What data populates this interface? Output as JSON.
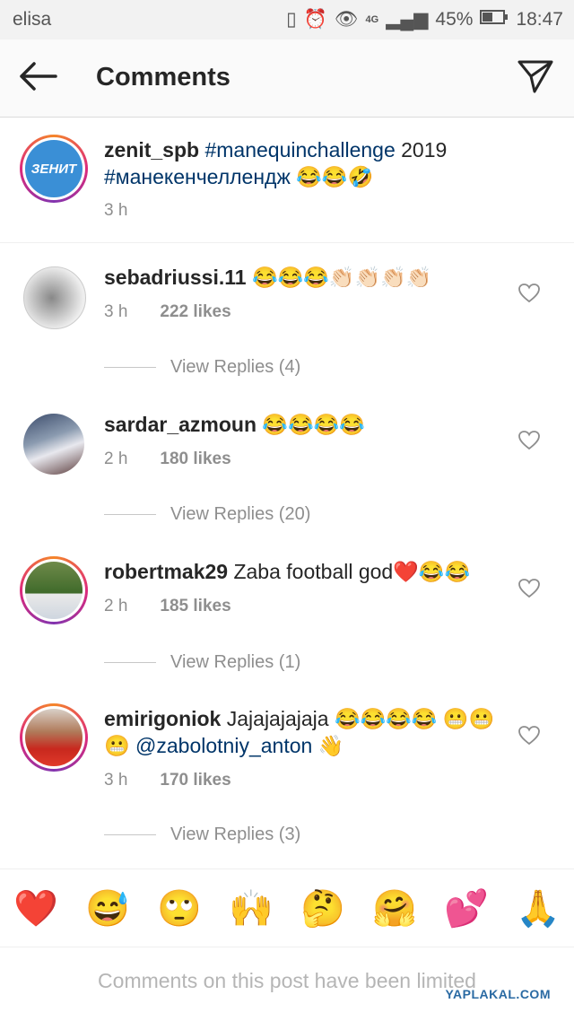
{
  "status_bar": {
    "carrier": "elisa",
    "network": "4G",
    "battery": "45%",
    "time": "18:47"
  },
  "header": {
    "title": "Comments"
  },
  "caption": {
    "username": "zenit_spb",
    "hashtag1": "#manequinchallenge",
    "year": "2019",
    "hashtag2": "#манекенчеллендж",
    "emoji": "😂😂🤣",
    "time": "3 h"
  },
  "comments": [
    {
      "username": "sebadriussi.11",
      "text": "😂😂😂👏🏻👏🏻👏🏻👏🏻",
      "time": "3 h",
      "likes": "222 likes",
      "replies": "View Replies (4)"
    },
    {
      "username": "sardar_azmoun",
      "text": "😂😂😂😂",
      "time": "2 h",
      "likes": "180 likes",
      "replies": "View Replies (20)"
    },
    {
      "username": "robertmak29",
      "text": "Zaba football god❤️😂😂",
      "time": "2 h",
      "likes": "185 likes",
      "replies": "View Replies (1)"
    },
    {
      "username": "emirigoniok",
      "text": "Jajajajajaja 😂😂😂😂 😬😬😬",
      "mention": "@zabolotniy_anton",
      "text2": "👋",
      "time": "3 h",
      "likes": "170 likes",
      "replies": "View Replies (3)"
    }
  ],
  "emoji_bar": [
    "❤️",
    "😅",
    "🙄",
    "🙌",
    "🤔",
    "🤗",
    "💕",
    "🙏"
  ],
  "limited_text": "Comments on this post have been limited",
  "watermark": "YAPLAKAL.COM",
  "colors": {
    "link": "#003569",
    "muted": "#8e8e8e",
    "ring_start": "#f58529",
    "ring_end": "#8134af"
  }
}
